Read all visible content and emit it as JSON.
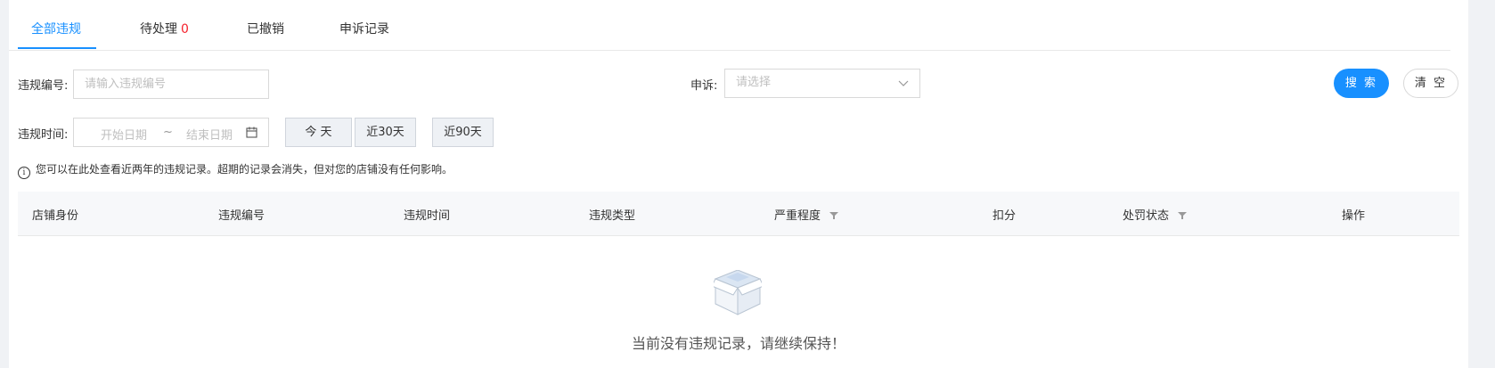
{
  "tabs": [
    {
      "label": "全部违规",
      "active": true
    },
    {
      "label": "待处理",
      "badge": "0",
      "active": false
    },
    {
      "label": "已撤销",
      "active": false
    },
    {
      "label": "申诉记录",
      "active": false
    }
  ],
  "filters": {
    "violation_no_label": "违规编号:",
    "violation_no_placeholder": "请输入违规编号",
    "appeal_label": "申诉:",
    "appeal_placeholder": "请选择",
    "time_label": "违规时间:",
    "start_date_placeholder": "开始日期",
    "date_separator": "~",
    "end_date_placeholder": "结束日期",
    "quick_today": "今 天",
    "quick_30": "近30天",
    "quick_90": "近90天"
  },
  "actions": {
    "search": "搜 索",
    "clear": "清 空"
  },
  "notice": "您可以在此处查看近两年的违规记录。超期的记录会消失，但对您的店铺没有任何影响。",
  "table": {
    "columns": [
      {
        "label": "店铺身份",
        "filter": false
      },
      {
        "label": "违规编号",
        "filter": false
      },
      {
        "label": "违规时间",
        "filter": false
      },
      {
        "label": "违规类型",
        "filter": false
      },
      {
        "label": "严重程度",
        "filter": true
      },
      {
        "label": "扣分",
        "filter": false
      },
      {
        "label": "处罚状态",
        "filter": true
      },
      {
        "label": "操作",
        "filter": false
      }
    ],
    "empty_text": "当前没有违规记录，请继续保持！"
  },
  "colors": {
    "primary": "#1890ff",
    "badge": "#f5222d"
  },
  "icons": [
    "chevron-down-icon",
    "calendar-icon",
    "info-icon",
    "filter-icon",
    "empty-box-icon"
  ]
}
